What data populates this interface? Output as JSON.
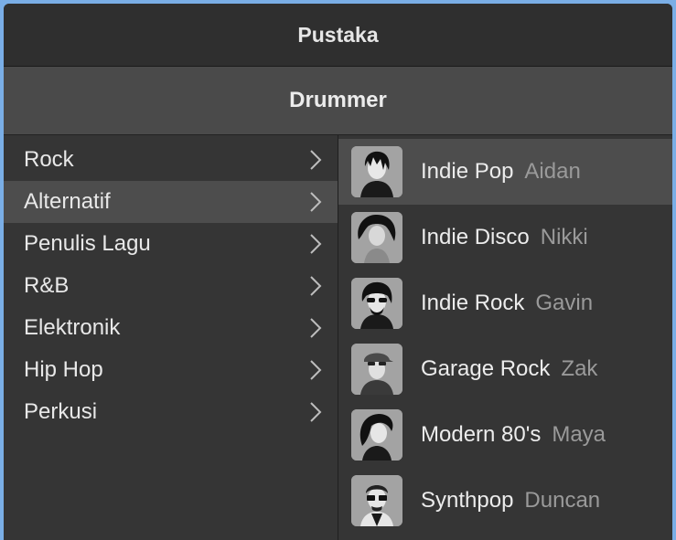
{
  "window": {
    "title": "Pustaka"
  },
  "section": {
    "title": "Drummer"
  },
  "genres": [
    {
      "label": "Rock",
      "icon": "chevron-right-icon"
    },
    {
      "label": "Alternatif",
      "icon": "chevron-right-icon",
      "selected": true
    },
    {
      "label": "Penulis Lagu",
      "icon": "chevron-right-icon"
    },
    {
      "label": "R&B",
      "icon": "chevron-right-icon"
    },
    {
      "label": "Elektronik",
      "icon": "chevron-right-icon"
    },
    {
      "label": "Hip Hop",
      "icon": "chevron-right-icon"
    },
    {
      "label": "Perkusi",
      "icon": "chevron-right-icon"
    }
  ],
  "drummers": [
    {
      "style": "Indie Pop",
      "name": "Aidan",
      "avatar": "drummer-avatar-icon",
      "selected": true
    },
    {
      "style": "Indie Disco",
      "name": "Nikki",
      "avatar": "drummer-avatar-icon"
    },
    {
      "style": "Indie Rock",
      "name": "Gavin",
      "avatar": "drummer-avatar-icon"
    },
    {
      "style": "Garage Rock",
      "name": "Zak",
      "avatar": "drummer-avatar-icon"
    },
    {
      "style": "Modern 80's",
      "name": "Maya",
      "avatar": "drummer-avatar-icon"
    },
    {
      "style": "Synthpop",
      "name": "Duncan",
      "avatar": "drummer-avatar-icon"
    }
  ],
  "colors": {
    "background": "#2e2e2e",
    "selected_row": "#4d4d4d",
    "section_bar": "#4a4a4a",
    "text_primary": "#ececec",
    "text_secondary": "#9a9a9a",
    "desktop": "#7aaee6"
  }
}
